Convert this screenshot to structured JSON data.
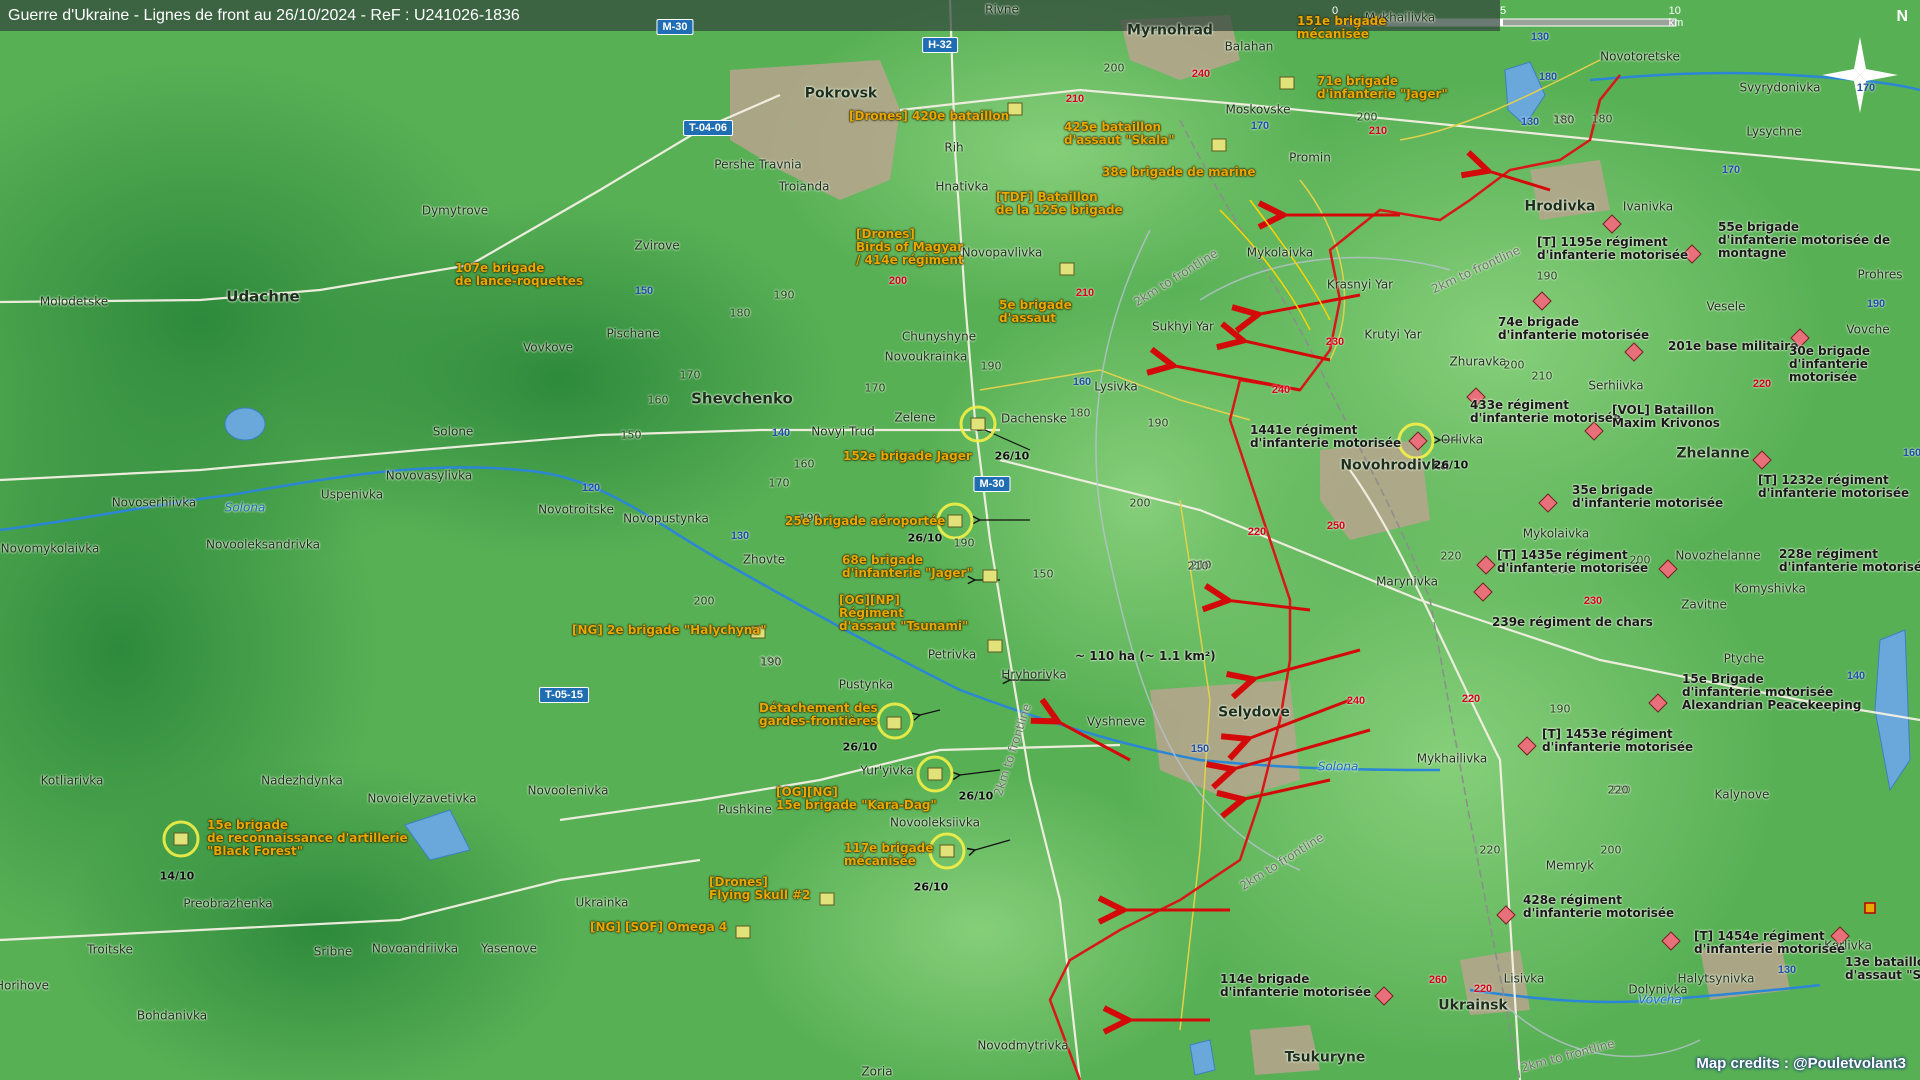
{
  "title": "Guerre d'Ukraine - Lignes de front au 26/10/2024 - ReF : U241026-1836",
  "scale": {
    "labels": [
      "0",
      "5",
      "10 km"
    ]
  },
  "north": "N",
  "credits": "Map credits : @Pouletvolant3",
  "colors": {
    "ukraine_unit": "#e8a800",
    "russia_unit": "#e8707a",
    "advance_arrow": "#d40a0a",
    "frontline": "#d81818",
    "river": "#2c86d6",
    "roads_blue": "#1f6db3"
  },
  "places": {
    "rivne": "Rivne",
    "mymohrad": "Myrnohrad",
    "balahan": "Balahan",
    "mykhailivka_n": "Mykhailivka",
    "novotoretske": "Novotoretske",
    "svyrydonivka": "Svyrydonivka",
    "pokrovsk": "Pokrovsk",
    "moskovske": "Moskovske",
    "rih": "Rih",
    "promin": "Promin",
    "lysychne": "Lysychne",
    "pershe_travnia": "Pershe Travnia",
    "troianda": "Troianda",
    "hnativka": "Hnativka",
    "hrodivka": "Hrodivka",
    "ivanivka": "Ivanivka",
    "dymytrove": "Dymytrove",
    "zvirove": "Zvirove",
    "novopavlivka": "Novopavlivka",
    "mykolaivka_n": "Mykolaivka",
    "krasnyi_yar": "Krasnyi Yar",
    "prohres": "Prohres",
    "udachne": "Udachne",
    "molodetske": "Molodetske",
    "pischane": "Pischane",
    "sukhyi_yar": "Sukhyi Yar",
    "krutyi_yar": "Krutyi Yar",
    "vesele": "Vesele",
    "vovche": "Vovche",
    "chunyshyne": "Chunyshyne",
    "vovkove": "Vovkove",
    "novoukrainka": "Novoukrainka",
    "zhuravka": "Zhuravka",
    "serhiivka": "Serhiivka",
    "shevchenko": "Shevchenko",
    "lysivka": "Lysivka",
    "zelene": "Zelene",
    "dachenske": "Dachenske",
    "novyi_trud": "Novyi Trud",
    "orlivka": "Orlivka",
    "solone": "Solone",
    "novovasylivka": "Novovasylivka",
    "novohrodivka": "Novohrodivka",
    "zhelanne": "Zhelanne",
    "novoserhiivka": "Novoserhiivka",
    "uspenivka": "Uspenivka",
    "novotroitske": "Novotroitske",
    "novopustynka": "Novopustynka",
    "mykolaivka_s": "Mykolaivka",
    "novomykolaivka": "Novomykolaivka",
    "novooleksandrivka": "Novooleksandrivka",
    "zhovte": "Zhovte",
    "novozhelanne": "Novozhelanne",
    "marynivka": "Marynivka",
    "komyshivka": "Komyshivka",
    "zavitne": "Zavitne",
    "petrivka": "Petrivka",
    "hryhorivka": "Hryhorivka",
    "ptychе": "Ptyche",
    "pustynka": "Pustynka",
    "selydove": "Selydove",
    "vyshneve": "Vyshneve",
    "yuriyivka": "Yur'yivka",
    "mykhailivka_s": "Mykhailivka",
    "kotliarivka": "Kotliarivka",
    "nadezhdynka": "Nadezhdynka",
    "novoielyzavetivka": "Novoielyzavetivka",
    "novoolenivka": "Novoolenivka",
    "pushkine": "Pushkine",
    "novooleksiivka": "Novooleksiivka",
    "kalynove": "Kalynove",
    "memryk": "Memryk",
    "preobrazhenka": "Preobrazhenka",
    "ukrainka": "Ukrainka",
    "karlivka": "Karlivka",
    "troitske": "Troitske",
    "sribne": "Sribne",
    "novoandriivka": "Novoandriivka",
    "yasenove": "Yasenove",
    "lisivka": "Lisivka",
    "halytsynivka": "Halytsynivka",
    "dolynivka": "Dolynivka",
    "horihove": "Horihove",
    "bohdanivka": "Bohdanivka",
    "ukrainsk": "Ukrainsk",
    "tsukuryne": "Tsukuryne",
    "novodmytrivka": "Novodmytrivka",
    "zoria": "Zoria"
  },
  "rivers": {
    "solona_w": "Solona",
    "solona_e": "Solona",
    "vovcha": "Vovcha"
  },
  "arcs": [
    "2km to frontline",
    "2km to frontline",
    "2km to frontline",
    "2km to frontline",
    "2km to frontline"
  ],
  "roads": [
    "M-30",
    "H-32",
    "T-04-06",
    "M-30",
    "T-05-15"
  ],
  "road_numbers": {
    "blue": [
      "180",
      "170",
      "130",
      "150",
      "160",
      "140",
      "120",
      "130",
      "170",
      "150",
      "190",
      "130",
      "140",
      "130",
      "170",
      "160"
    ],
    "red": [
      "210",
      "240",
      "210",
      "200",
      "210",
      "230",
      "240",
      "220",
      "250",
      "220",
      "230",
      "220",
      "240",
      "260",
      "220"
    ]
  },
  "altitudes": [
    "200",
    "180",
    "190",
    "180",
    "200",
    "190",
    "170",
    "160",
    "150",
    "170",
    "180",
    "190",
    "190",
    "200",
    "210",
    "190",
    "150",
    "160",
    "170",
    "190",
    "200",
    "190",
    "210",
    "200",
    "220",
    "200",
    "210",
    "220",
    "190",
    "180",
    "220",
    "200",
    "180",
    "190",
    "220",
    "200",
    "210"
  ],
  "annotations": {
    "area_gain": "~ 110 ha (~ 1.1 km²)"
  },
  "units_ua": [
    {
      "lines": [
        "151e brigade",
        "mécanisée"
      ]
    },
    {
      "lines": [
        "71e brigade",
        "d'infanterie \"Jager\""
      ]
    },
    {
      "lines": [
        "[Drones] 420e bataillon"
      ]
    },
    {
      "lines": [
        "425e bataillon",
        "d'assaut \"Skala\""
      ]
    },
    {
      "lines": [
        "38e brigade de marine"
      ]
    },
    {
      "lines": [
        "[TDF] Bataillon",
        "de la 125e brigade"
      ]
    },
    {
      "lines": [
        "[Drones]",
        "Birds of Magyar",
        "/ 414e régiment"
      ]
    },
    {
      "lines": [
        "107e brigade",
        "de lance-roquettes"
      ]
    },
    {
      "lines": [
        "5e brigade",
        "d'assaut"
      ]
    },
    {
      "lines": [
        "152e brigade Jager"
      ]
    },
    {
      "lines": [
        "25e brigade aéroportée"
      ]
    },
    {
      "lines": [
        "68e brigade",
        "d'infanterie \"Jager\""
      ]
    },
    {
      "lines": [
        "[OG][NP]",
        "Régiment",
        "d'assaut \"Tsunami\""
      ]
    },
    {
      "lines": [
        "[NG] 2e brigade \"Halychyna\""
      ]
    },
    {
      "lines": [
        "Détachement des",
        "gardes-frontières"
      ]
    },
    {
      "lines": [
        "[OG][NG]",
        "15e brigade \"Kara-Dag\""
      ]
    },
    {
      "lines": [
        "117e brigade",
        "mécanisée"
      ]
    },
    {
      "lines": [
        "15e brigade",
        "de reconnaissance d'artillerie",
        "\"Black Forest\""
      ]
    },
    {
      "lines": [
        "[Drones]",
        "Flying Skull #2"
      ]
    },
    {
      "lines": [
        "[NG] [SOF] Omega 4"
      ]
    }
  ],
  "units_ru": [
    {
      "lines": [
        "[T] 1195e régiment",
        "d'infanterie motorisée"
      ]
    },
    {
      "lines": [
        "55e brigade",
        "d'infanterie motorisée de",
        "montagne"
      ]
    },
    {
      "lines": [
        "74e brigade",
        "d'infanterie motorisée"
      ]
    },
    {
      "lines": [
        "201e base militaire"
      ]
    },
    {
      "lines": [
        "30e brigade",
        "d'infanterie",
        "motorisée"
      ]
    },
    {
      "lines": [
        "433e régiment",
        "d'infanterie motorisée"
      ]
    },
    {
      "lines": [
        "[VOL] Bataillon",
        "Maxim Krivonos"
      ]
    },
    {
      "lines": [
        "1441e régiment",
        "d'infanterie motorisée"
      ]
    },
    {
      "lines": [
        "[T] 1232e régiment",
        "d'infanterie motorisée"
      ]
    },
    {
      "lines": [
        "35e brigade",
        "d'infanterie motorisée"
      ]
    },
    {
      "lines": [
        "[T] 1435e régiment",
        "d'infanterie motorisée"
      ]
    },
    {
      "lines": [
        "228e régiment",
        "d'infanterie motorisée"
      ]
    },
    {
      "lines": [
        "239e régiment de chars"
      ]
    },
    {
      "lines": [
        "15e Brigade",
        "d'infanterie motorisée",
        "Alexandrian Peacekeeping"
      ]
    },
    {
      "lines": [
        "[T] 1453e régiment",
        "d'infanterie motorisée"
      ]
    },
    {
      "lines": [
        "428e régiment",
        "d'infanterie motorisée"
      ]
    },
    {
      "lines": [
        "[T] 1454e régiment",
        "d'infanterie motorisée"
      ]
    },
    {
      "lines": [
        "13e bataillon",
        "d'assaut \"So"
      ]
    },
    {
      "lines": [
        "114e brigade",
        "d'infanterie motorisée"
      ]
    }
  ],
  "dates": [
    "26/10",
    "26/10",
    "26/10",
    "26/10",
    "26/10",
    "26/10",
    "14/10"
  ]
}
